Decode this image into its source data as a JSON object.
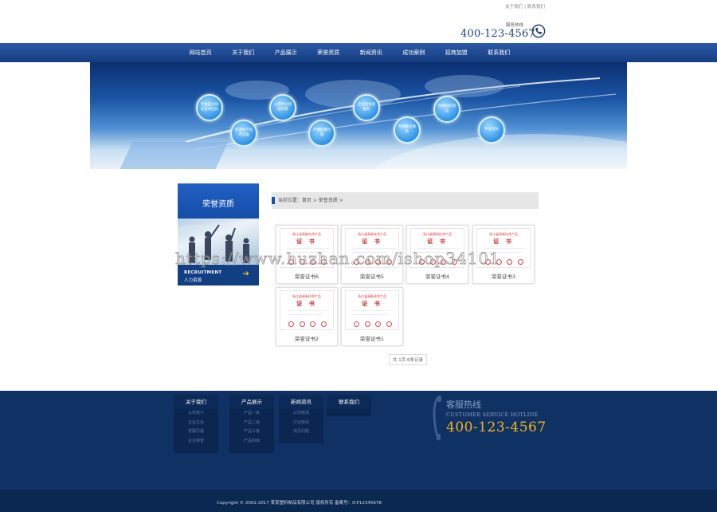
{
  "top_links": [
    "关于我们",
    "联系我们"
  ],
  "header": {
    "hotline_label": "服务热线",
    "hotline_number": "400-123-4567"
  },
  "nav": {
    "items": [
      "网站首页",
      "关于我们",
      "产品展示",
      "荣誉资质",
      "新闻资讯",
      "成功案例",
      "招商加盟",
      "联系我们"
    ]
  },
  "banner": {
    "bubbles": [
      "专业自主研发技术团队",
      "先进生产技术设备",
      "十年行业经验积累",
      "严格质量检测",
      "全方位售后服务",
      "完善服务体系",
      "优质材料保证",
      "专业团队"
    ]
  },
  "sidebar": {
    "title": "荣誉资质",
    "caption_en": "RECRUITMENT",
    "caption_cn": "人力资源"
  },
  "breadcrumb": "当前位置：首页 > 荣誉资质 >",
  "certificates": {
    "header": "浙江省高新技术产品",
    "title": "证 书",
    "items": [
      "荣誉证书6",
      "荣誉证书5",
      "荣誉证书4",
      "荣誉证书3",
      "荣誉证书2",
      "荣誉证书1"
    ]
  },
  "pager": "共 1页 6条记录",
  "watermark": "https://www.huzhan.com/ishop34101",
  "footer": {
    "columns": [
      {
        "title": "关于我们",
        "items": [
          "公司简介",
          "企业文化",
          "发展历程",
          "企业荣誉"
        ]
      },
      {
        "title": "产品展示",
        "items": [
          "产品一级",
          "产品二级",
          "产品三级",
          "产品四级"
        ]
      },
      {
        "title": "新闻资讯",
        "items": [
          "公司新闻",
          "行业新闻",
          "常见问题"
        ]
      },
      {
        "title": "联系我们",
        "items": []
      }
    ],
    "hotline_label": "客服热线",
    "hotline_sub": "CUSTOMER SERVICE HOTLINE",
    "hotline_number": "400-123-4567",
    "copyright": "Copyright © 2002-2017 某某塑料制品有限公司 版权所有 备案号：ICP12345678"
  },
  "colors": {
    "brand_blue": "#1a4fa8",
    "nav_blue": "#163c7e",
    "footer_blue": "#0f3163",
    "hotline_gold": "#f4b41a"
  }
}
